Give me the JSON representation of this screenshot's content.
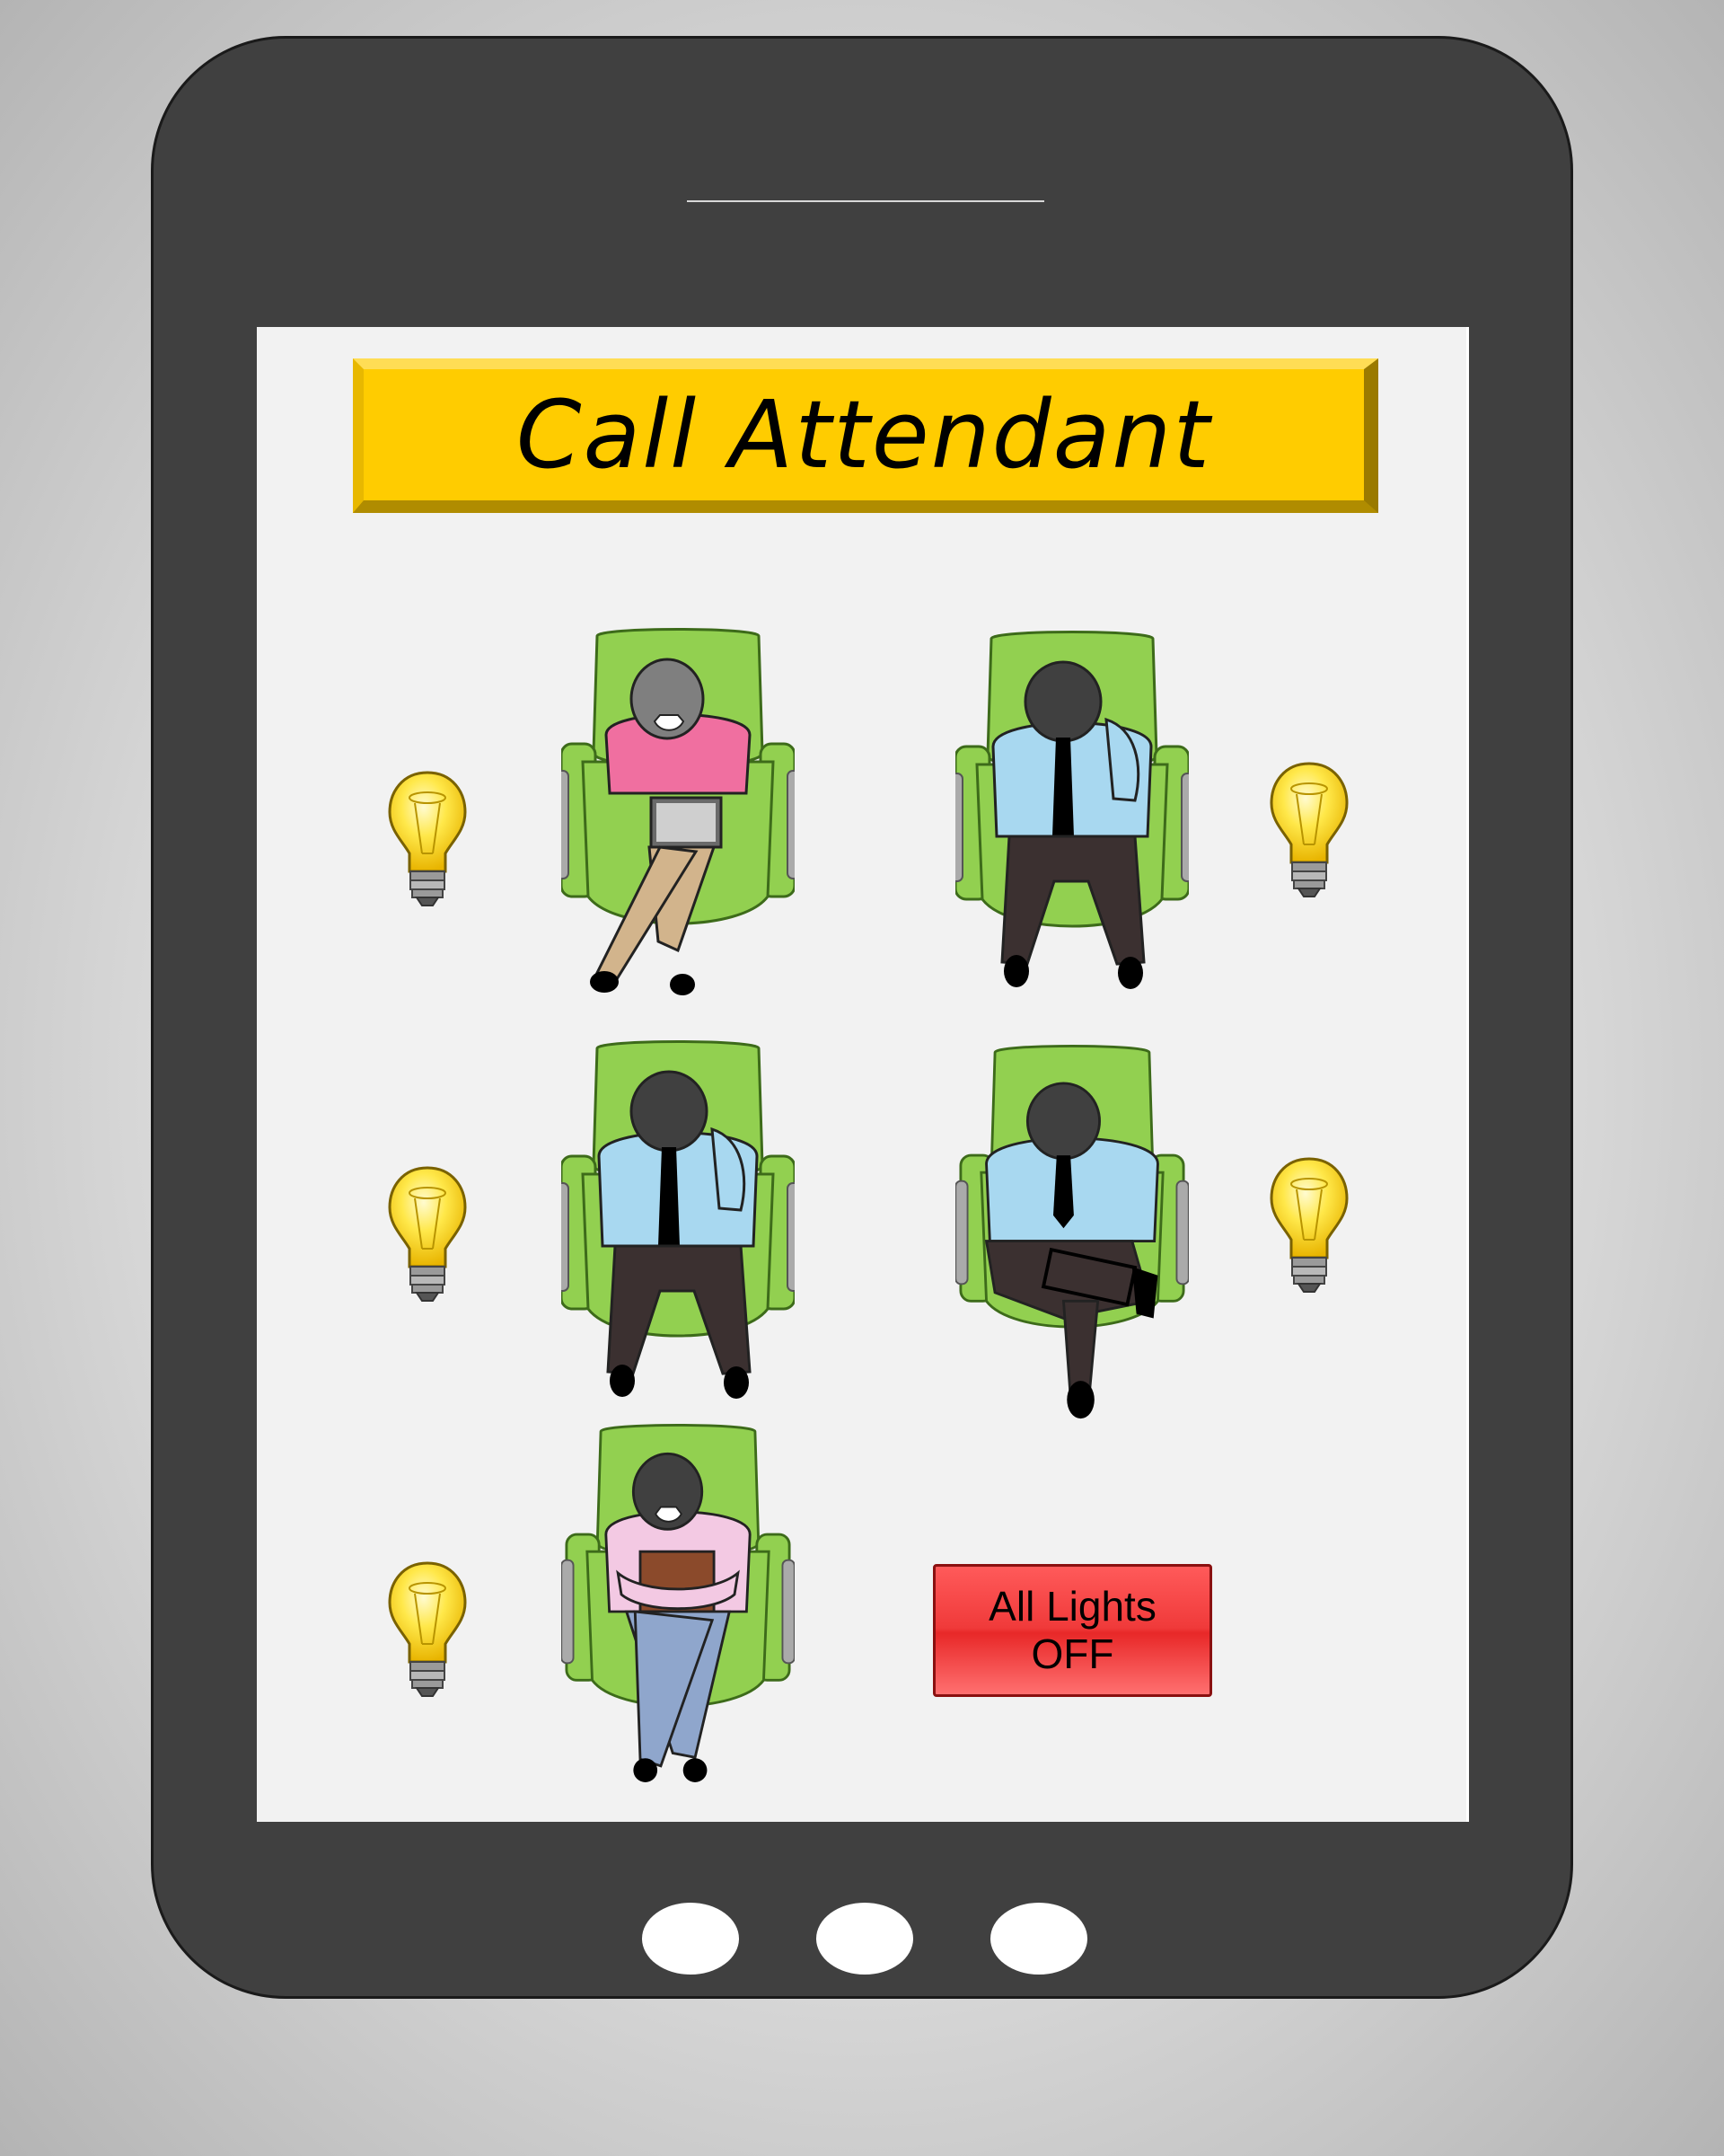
{
  "app": {
    "call_attendant_label": "Call Attendant",
    "lights_off_label_line1": "All Lights",
    "lights_off_label_line2": "OFF"
  },
  "seats": [
    {
      "id": "seat-1",
      "person": "woman-pink-top-tablet",
      "light": "on"
    },
    {
      "id": "seat-2",
      "person": "man-blue-shirt-hand-to-face",
      "light": "on"
    },
    {
      "id": "seat-3",
      "person": "man-blue-shirt-hand-to-face",
      "light": "on"
    },
    {
      "id": "seat-4",
      "person": "man-blue-shirt-tablet-crossed-legs",
      "light": "on"
    },
    {
      "id": "seat-5",
      "person": "woman-lilac-top-book",
      "light": "on"
    }
  ],
  "icons": {
    "bulb": "light-bulb-icon",
    "home_buttons": [
      "home-button-icon",
      "home-button-icon",
      "home-button-icon"
    ]
  },
  "colors": {
    "device_body": "#404040",
    "screen": "#f2f2f2",
    "call_button": "#ffcc00",
    "lights_off_button": "#f03a3a",
    "bulb": "#ffde1a",
    "seat": "#92d050",
    "shirt_blue": "#a8d8f0",
    "top_pink": "#f06fa0",
    "top_lilac": "#f3c9e3"
  }
}
